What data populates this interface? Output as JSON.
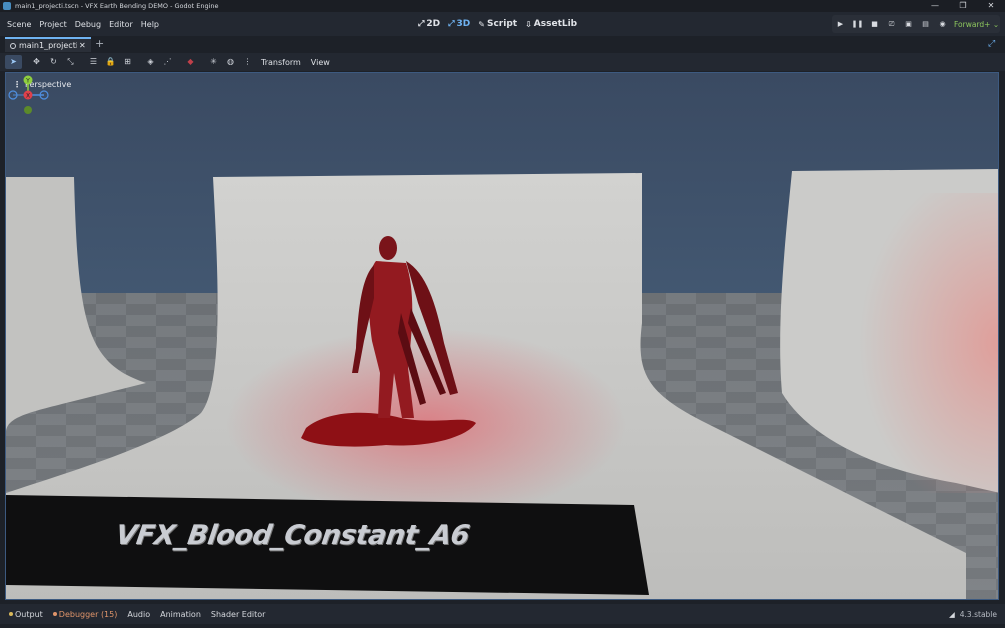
{
  "window": {
    "title": "main1_projecti.tscn - VFX Earth Bending DEMO - Godot Engine",
    "controls": [
      "—",
      "❐",
      "✕"
    ]
  },
  "menu": [
    "Scene",
    "Project",
    "Debug",
    "Editor",
    "Help"
  ],
  "modes": [
    {
      "label": "2D",
      "icon": "⤢"
    },
    {
      "label": "3D",
      "icon": "⤢"
    },
    {
      "label": "Script",
      "icon": "✎"
    },
    {
      "label": "AssetLib",
      "icon": "⇩"
    }
  ],
  "run_controls": {
    "renderer": "Forward+ ⌄"
  },
  "scene_tab": {
    "label": "main1_projecti",
    "close": "✕",
    "add": "+"
  },
  "toolbar": {
    "transform": "Transform",
    "view": "View"
  },
  "viewport": {
    "label": "Perspective",
    "gizmo": {
      "y": "Y",
      "x": "X"
    },
    "world_text": "VFX_Blood_Constant_A6"
  },
  "bottom_tabs": {
    "output": "Output",
    "debugger": "Debugger (15)",
    "audio": "Audio",
    "animation": "Animation",
    "shader_editor": "Shader Editor"
  },
  "version": "4.3.stable",
  "colors": {
    "accent": "#6fb3f2",
    "renderer_green": "#8fc95e",
    "debugger_orange": "#e0956a",
    "output_dot": "#d9b85a",
    "blood_red": "#c0404a",
    "axis_x": "#e0404a",
    "axis_y": "#8fcf3e",
    "axis_z": "#4f8fe0"
  }
}
